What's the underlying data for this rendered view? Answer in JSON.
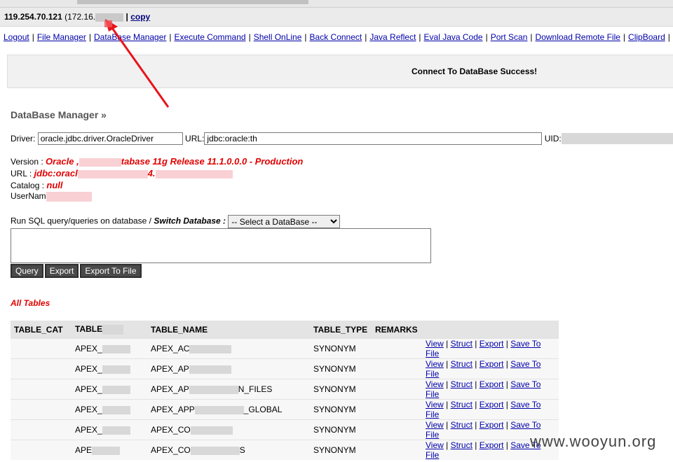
{
  "host": {
    "ip": "119.254.70.121",
    "inner_ip": "(172.16.",
    "copy_label": "copy",
    "separator": "|"
  },
  "menu": [
    "Logout",
    "File Manager",
    "DataBase Manager",
    "Execute Command",
    "Shell OnLine",
    "Back Connect",
    "Java Reflect",
    "Eval Java Code",
    "Port Scan",
    "Download Remote File",
    "ClipBoard"
  ],
  "notice": "Connect To DataBase Success!",
  "heading": "DataBase Manager »",
  "connect": {
    "driver_label": "Driver:",
    "driver_value": "oracle.jdbc.driver.OracleDriver",
    "url_label": "URL:",
    "url_value": "jdbc:oracle:th",
    "uid_label": "UID:"
  },
  "info": {
    "version_label": "Version : ",
    "version_value": "Oracle ,",
    "version_tail": "tabase 11g Release 11.1.0.0.0 - Production",
    "url_label": "URL : ",
    "url_value": "jdbc:oracl",
    "url_tail": "4.",
    "catalog_label": "Catalog : ",
    "catalog_value": "null",
    "username_label": "UserNam"
  },
  "sql": {
    "run_label": "Run SQL query/queries on database / ",
    "switch_label": "Switch Database :",
    "select_value": "-- Select a DataBase --"
  },
  "buttons": {
    "query": "Query",
    "export": "Export",
    "export_file": "Export To File"
  },
  "all_tables": "All Tables",
  "table": {
    "headers": [
      "TABLE_CAT",
      "TABLE",
      "TABLE_NAME",
      "TABLE_TYPE",
      "REMARKS"
    ],
    "rows": [
      {
        "schema": "APEX_",
        "name": "APEX_AC",
        "type": "SYNONYM"
      },
      {
        "schema": "APEX_",
        "name": "APEX_AP",
        "type": "SYNONYM"
      },
      {
        "schema": "APEX_",
        "name": "APEX_AP",
        "name_tail": "N_FILES",
        "type": "SYNONYM"
      },
      {
        "schema": "APEX_",
        "name": "APEX_APP",
        "name_tail": "_GLOBAL",
        "type": "SYNONYM"
      },
      {
        "schema": "APEX_",
        "name": "APEX_CO",
        "type": "SYNONYM"
      },
      {
        "schema": "APE",
        "name": "APEX_CO",
        "name_tail": "S",
        "type": "SYNONYM"
      }
    ],
    "actions": [
      "View",
      "Struct",
      "Export",
      "Save To File"
    ]
  },
  "watermark": "www.wooyun.org",
  "colors": {
    "accent_red": "#e00000",
    "link_blue": "#0000aa",
    "button_dark": "#4a4a4a"
  }
}
